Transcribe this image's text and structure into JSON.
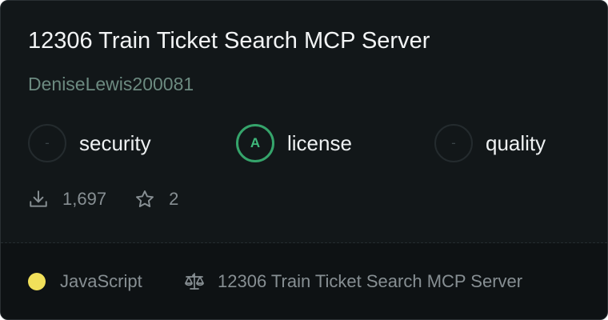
{
  "server": {
    "title": "12306 Train Ticket Search MCP Server",
    "author": "DeniseLewis200081"
  },
  "scores": {
    "security": {
      "grade": "-",
      "label": "security"
    },
    "license": {
      "grade": "A",
      "label": "license"
    },
    "quality": {
      "grade": "-",
      "label": "quality"
    }
  },
  "stats": {
    "downloads": "1,697",
    "stars": "2",
    "download_icon": "download-icon",
    "star_icon": "star-icon"
  },
  "footer": {
    "language": "JavaScript",
    "language_color": "#f1e05a",
    "license_name": "12306 Train Ticket Search MCP Server",
    "license_icon": "scale-icon"
  },
  "colors": {
    "grade_good": "#3fb97b",
    "background": "#121719"
  }
}
